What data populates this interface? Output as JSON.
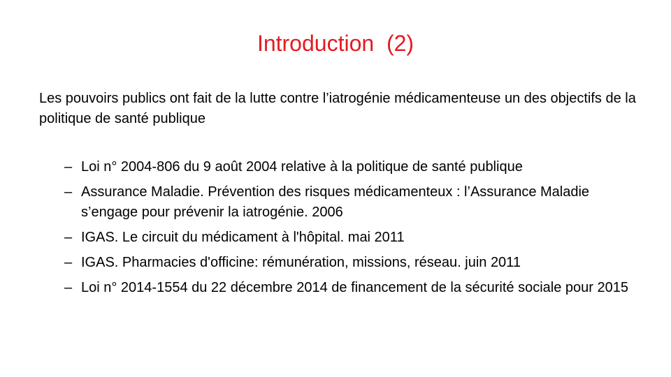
{
  "slide": {
    "title": "Introduction  (2)",
    "intro": "Les pouvoirs publics ont fait de la lutte contre l’iatrogénie médicamenteuse un des objectifs de la politique de santé publique",
    "bullet_marker": "–",
    "bullets": [
      "Loi n° 2004-806 du 9 août 2004 relative à la politique de santé publique",
      "Assurance Maladie. Prévention des risques médicamenteux : l’Assurance Maladie s’engage pour prévenir la iatrogénie. 2006",
      "IGAS. Le circuit du médicament à l'hôpital. mai 2011",
      "IGAS. Pharmacies d'officine: rémunération, missions, réseau. juin 2011",
      "Loi n°  2014-1554 du 22 décembre 2014 de financement de la sécurité sociale pour 2015"
    ]
  },
  "colors": {
    "title": "#e31b23",
    "text": "#000000",
    "background": "#ffffff"
  }
}
